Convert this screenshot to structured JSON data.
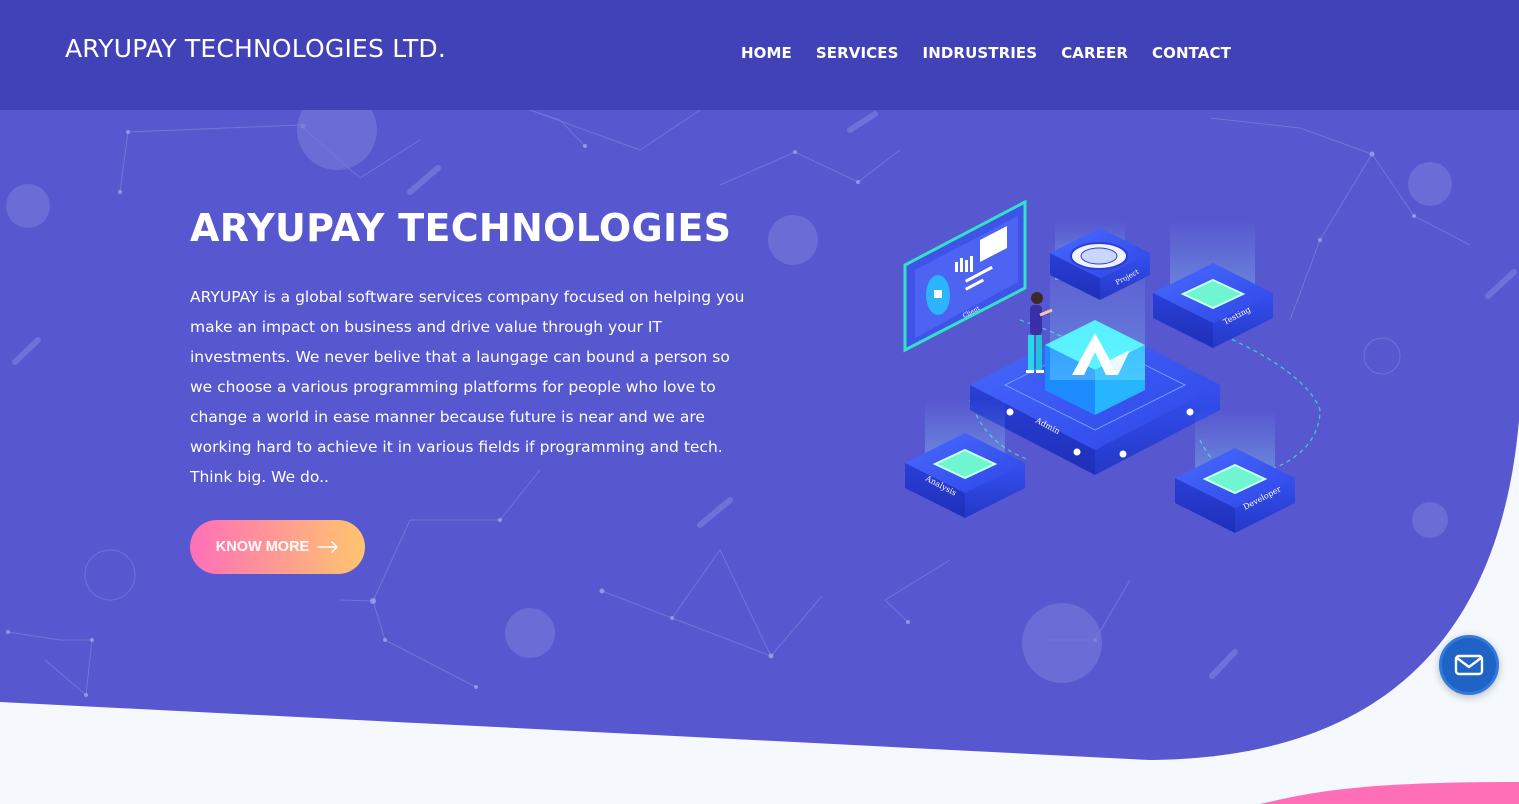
{
  "header": {
    "brand": "ARYUPAY TECHNOLOGIES LTD.",
    "nav": [
      "HOME",
      "SERVICES",
      "INDRUSTRIES",
      "CAREER",
      "CONTACT"
    ]
  },
  "hero": {
    "title": "ARYUPAY TECHNOLOGIES",
    "description": "ARYUPAY is a global software services company focused on helping you make an impact on business and drive value through your IT investments. We never belive that a laungage can bound a person so we choose a various programming platforms for people who love to change a world in ease manner because future is near and we are working hard to achieve it in various fields if programming and tech. Think big. We do..",
    "cta_label": "KNOW MORE"
  },
  "illustration": {
    "labels": [
      "Client",
      "Project",
      "Testing",
      "Admin",
      "Analysis",
      "Developer"
    ]
  },
  "colors": {
    "header": "#4242b8",
    "hero": "#5757cf",
    "cta_start": "#ff6fb8",
    "cta_end": "#ffc56e",
    "fab": "#1f63c6"
  },
  "icons": {
    "cta": "arrow-right-icon",
    "fab": "mail-icon"
  }
}
